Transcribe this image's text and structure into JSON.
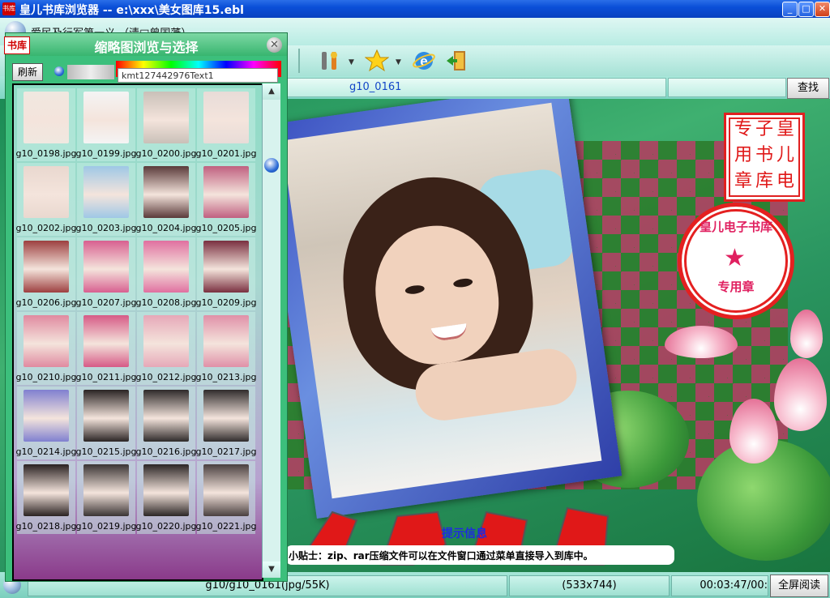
{
  "window": {
    "title": "皇儿书库浏览器 -- e:\\xxx\\美女图库15.ebl",
    "app_icon_text": "书库",
    "controls": {
      "minimize": "_",
      "maximize": "□",
      "close": "✕"
    }
  },
  "menubar": {
    "text": "爱民及行军第一义 （清□曾国藩）"
  },
  "toolbar": {
    "buttons": [
      {
        "name": "tools-icon"
      },
      {
        "name": "star-favorites-icon"
      },
      {
        "name": "internet-explorer-icon"
      },
      {
        "name": "exit-door-icon"
      }
    ]
  },
  "searchbar": {
    "current_file": "g10_0161",
    "search_value": "",
    "search_button": "查找"
  },
  "viewer": {
    "seal_square_chars": [
      "专",
      "子",
      "皇",
      "用",
      "书",
      "儿",
      "章",
      "库",
      "电"
    ],
    "seal_circle_name": "皇儿电子书库",
    "seal_circle_star": "★",
    "seal_circle_use": "专用章",
    "tip_title": "提示信息",
    "tip_text": "小贴士：zip、rar压缩文件可以在文件窗口通过菜单直接导入到库中。"
  },
  "statusbar": {
    "path": "g10/g10_0161(jpg/55K)",
    "dimensions": "(533x744)",
    "time": "00:03:47/00:",
    "fullscreen_button": "全屏阅读"
  },
  "thumb_panel": {
    "title": "缩略图浏览与选择",
    "mark": "书库",
    "close": "✕",
    "refresh_button": "刷新",
    "text_field": "kmt127442976Text1",
    "scroll_up": "▲",
    "scroll_down": "▼",
    "thumbnails": [
      {
        "label": "g10_0198.jpg",
        "color": "#f0e8e0"
      },
      {
        "label": "g10_0199.jpg",
        "color": "#f4f4f4"
      },
      {
        "label": "g10_0200.jpg",
        "color": "#c9c0b8"
      },
      {
        "label": "g10_0201.jpg",
        "color": "#e8dcd8"
      },
      {
        "label": "g10_0202.jpg",
        "color": "#e9d8cf"
      },
      {
        "label": "g10_0203.jpg",
        "color": "#9fc8e6"
      },
      {
        "label": "g10_0204.jpg",
        "color": "#5a3a3a"
      },
      {
        "label": "g10_0205.jpg",
        "color": "#c06080"
      },
      {
        "label": "g10_0206.jpg",
        "color": "#9d4040"
      },
      {
        "label": "g10_0207.jpg",
        "color": "#d86090"
      },
      {
        "label": "g10_0208.jpg",
        "color": "#e070a0"
      },
      {
        "label": "g10_0209.jpg",
        "color": "#7a3040"
      },
      {
        "label": "g10_0210.jpg",
        "color": "#e08aa0"
      },
      {
        "label": "g10_0211.jpg",
        "color": "#d65a86"
      },
      {
        "label": "g10_0212.jpg",
        "color": "#e6a8b8"
      },
      {
        "label": "g10_0213.jpg",
        "color": "#e090a8"
      },
      {
        "label": "g10_0214.jpg",
        "color": "#8080d0"
      },
      {
        "label": "g10_0215.jpg",
        "color": "#2a2424"
      },
      {
        "label": "g10_0216.jpg",
        "color": "#2e2a2a"
      },
      {
        "label": "g10_0217.jpg",
        "color": "#302c2c"
      },
      {
        "label": "g10_0218.jpg",
        "color": "#2a2222"
      },
      {
        "label": "g10_0219.jpg",
        "color": "#3a3434"
      },
      {
        "label": "g10_0220.jpg",
        "color": "#2c2626"
      },
      {
        "label": "g10_0221.jpg",
        "color": "#4a4040"
      }
    ]
  }
}
